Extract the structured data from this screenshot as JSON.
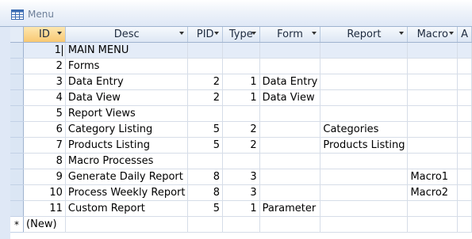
{
  "window": {
    "title": "Menu",
    "icon": "table-icon"
  },
  "columns": [
    {
      "key": "ID",
      "label": "ID",
      "width": 56
    },
    {
      "key": "Desc",
      "label": "Desc",
      "width": 154
    },
    {
      "key": "PID",
      "label": "PID",
      "width": 49
    },
    {
      "key": "Type",
      "label": "Type",
      "width": 50
    },
    {
      "key": "Form",
      "label": "Form",
      "width": 76
    },
    {
      "key": "Report",
      "label": "Report",
      "width": 107
    },
    {
      "key": "Macro",
      "label": "Macro",
      "width": 66
    },
    {
      "key": "A",
      "label": "A",
      "width": 9
    }
  ],
  "rows": [
    {
      "ID": "1",
      "Desc": "MAIN MENU",
      "PID": "",
      "Type": "",
      "Form": "",
      "Report": "",
      "Macro": ""
    },
    {
      "ID": "2",
      "Desc": "Forms",
      "PID": "",
      "Type": "",
      "Form": "",
      "Report": "",
      "Macro": ""
    },
    {
      "ID": "3",
      "Desc": "Data Entry",
      "PID": "2",
      "Type": "1",
      "Form": "Data Entry",
      "Report": "",
      "Macro": ""
    },
    {
      "ID": "4",
      "Desc": "Data View",
      "PID": "2",
      "Type": "1",
      "Form": "Data View",
      "Report": "",
      "Macro": ""
    },
    {
      "ID": "5",
      "Desc": "Report Views",
      "PID": "",
      "Type": "",
      "Form": "",
      "Report": "",
      "Macro": ""
    },
    {
      "ID": "6",
      "Desc": "Category Listing",
      "PID": "5",
      "Type": "2",
      "Form": "",
      "Report": "Categories",
      "Macro": ""
    },
    {
      "ID": "7",
      "Desc": "Products Listing",
      "PID": "5",
      "Type": "2",
      "Form": "",
      "Report": "Products Listing",
      "Macro": ""
    },
    {
      "ID": "8",
      "Desc": "Macro Processes",
      "PID": "",
      "Type": "",
      "Form": "",
      "Report": "",
      "Macro": ""
    },
    {
      "ID": "9",
      "Desc": "Generate Daily Report",
      "PID": "8",
      "Type": "3",
      "Form": "",
      "Report": "",
      "Macro": "Macro1"
    },
    {
      "ID": "10",
      "Desc": "Process Weekly Report",
      "PID": "8",
      "Type": "3",
      "Form": "",
      "Report": "",
      "Macro": "Macro2"
    },
    {
      "ID": "11",
      "Desc": "Custom Report",
      "PID": "5",
      "Type": "1",
      "Form": "Parameter",
      "Report": "",
      "Macro": ""
    }
  ],
  "new_row": {
    "selector": "*",
    "ID": "(New)"
  }
}
